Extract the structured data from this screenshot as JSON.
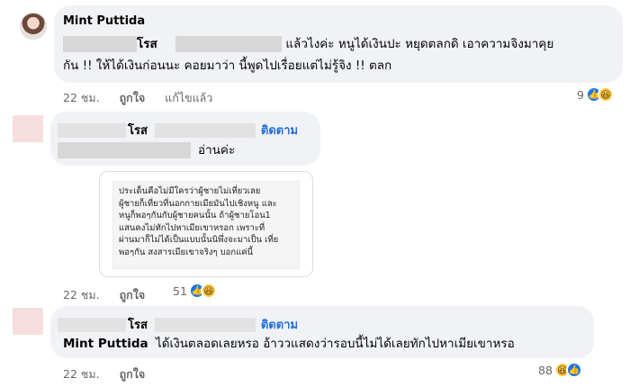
{
  "comments": [
    {
      "author": "Mint Puttida",
      "line1_suffix": "โรส",
      "line1_text": "แล้วไงค่ะ หนูได้เงินปะ หยุดตลกดิ เอาความจิงมาคุย",
      "line2_text": "กัน !! ให้ได้เงินก่อนนะ คอยมาว่า นี้พูดไปเรื่อยแต่ไม่รู้จิง !! ตลก",
      "time": "22 ชม.",
      "like_label": "ถูกใจ",
      "edited_label": "แก้ไขแล้ว",
      "reaction_count": "9"
    },
    {
      "author_suffix": "โรส",
      "follow_label": "ติดตาม",
      "text": "อ่านค่ะ",
      "image_text": "ประเด็นคือไม่มีใครว่าผู้ชายไม่เที่ยวเลย\nผู้ชายก็เที่ยวที่นอกกายเมียมันไปเชิงหนู และ\nหนูก็พอๆกันกับผู้ชายคนนั้น ถ้าผู้ชายโอน1\nแสนคงไม่ทักไปหาเมียเขาหรอก เพราะที่\nผ่านมาก็ไม่ได้เป็นแบบนั้นนิพึ่งจะมาเป็น เที่ย\nพอๆกัน สงสารเมียเขาจริงๆ บอกแค่นี้",
      "time": "22 ชม.",
      "like_label": "ถูกใจ",
      "reaction_count": "51"
    },
    {
      "author_suffix": "โรส",
      "follow_label": "ติดตาม",
      "mention": "Mint Puttida",
      "text": "ได้เงินตลอดเลยหรอ อ้าววแสดงว่ารอบนี้ไม่ได้เลยทักไปหาเมียเขาหรอ",
      "time": "22 ชม.",
      "like_label": "ถูกใจ",
      "reaction_count": "88"
    }
  ],
  "icons": {
    "like": "like-icon",
    "haha": "haha-icon"
  },
  "colors": {
    "bubble": "#f0f2f5",
    "link_blue": "#216fdb",
    "like_blue": "#1877f2",
    "haha_yellow": "#f7c94a",
    "meta_gray": "#65676b"
  }
}
